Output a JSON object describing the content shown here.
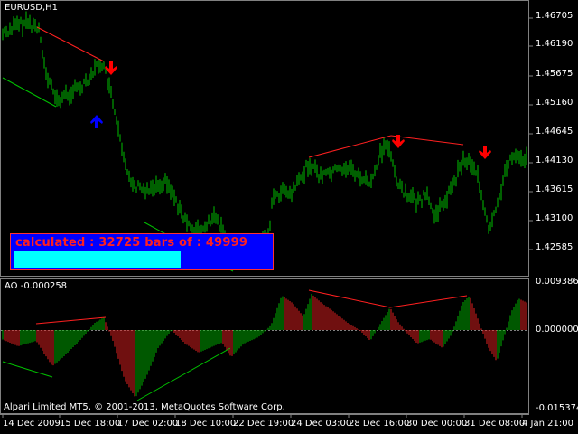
{
  "chart": {
    "symbol_title": "EURUSD,H1",
    "copyright": "Alpari Limited MT5, © 2001-2013, MetaQuotes Software Corp.",
    "price_axis_labels": [
      "1.46705",
      "1.46190",
      "1.45675",
      "1.45160",
      "1.44645",
      "1.44130",
      "1.43615",
      "1.43100",
      "1.42585"
    ],
    "time_axis_labels": [
      "14 Dec 2009",
      "15 Dec 18:00",
      "17 Dec 02:00",
      "18 Dec 10:00",
      "22 Dec 19:00",
      "24 Dec 03:00",
      "28 Dec 16:00",
      "30 Dec 00:00",
      "31 Dec 08:00",
      "4 Jan 21:00"
    ],
    "colors": {
      "candle": "#00c000",
      "divergence_line": "#ff2020",
      "arrow_down": "#ff0000",
      "arrow_up": "#0000ff",
      "ao_up": "#00b000",
      "ao_down": "#e02020",
      "grid": "#808080"
    }
  },
  "indicator": {
    "title": "AO -0.000258",
    "axis_labels": [
      "0.009386",
      "0.000000",
      "-0.015374"
    ]
  },
  "progress": {
    "text": "calculated : 32725 bars of : 49999",
    "fraction": 0.6545
  },
  "arrows": [
    {
      "type": "down",
      "name": "sell-arrow-1"
    },
    {
      "type": "up",
      "name": "buy-arrow-1"
    },
    {
      "type": "down",
      "name": "sell-arrow-2"
    },
    {
      "type": "down",
      "name": "sell-arrow-3"
    }
  ]
}
